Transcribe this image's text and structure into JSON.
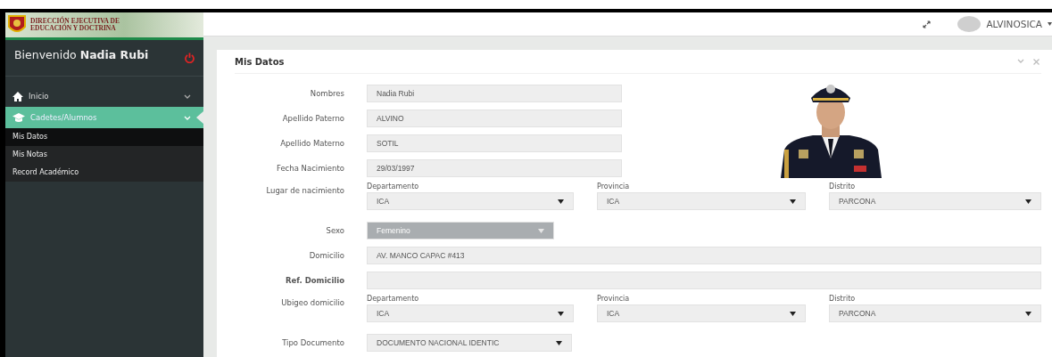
{
  "logo": {
    "line1": "DIRECCIÓN EJECUTIVA DE",
    "line2": "EDUCACIÓN Y DOCTRINA"
  },
  "header": {
    "user": "ALVINOSICA"
  },
  "sidebar": {
    "welcome": "Bienvenido",
    "user": "Nadia Rubi",
    "items": [
      {
        "label": "Inicio",
        "selected": false,
        "expanded": false
      },
      {
        "label": "Cadetes/Alumnos",
        "selected": true,
        "expanded": true,
        "children": [
          {
            "label": "Mis Datos",
            "selected": true
          },
          {
            "label": "Mis Notas",
            "selected": false
          },
          {
            "label": "Record Académico",
            "selected": false
          }
        ]
      }
    ]
  },
  "panel": {
    "title": "Mis Datos",
    "fields": [
      {
        "kind": "text",
        "label": "Nombres",
        "value": "Nadia Rubi"
      },
      {
        "kind": "text",
        "label": "Apellido Paterno",
        "value": "ALVINO"
      },
      {
        "kind": "text",
        "label": "Apellido Materno",
        "value": "SOTIL"
      },
      {
        "kind": "text",
        "label": "Fecha Nacimiento",
        "value": "29/03/1997"
      },
      {
        "kind": "location",
        "label": "Lugar de nacimiento",
        "parts": [
          {
            "caption": "Departamento",
            "value": "ICA"
          },
          {
            "caption": "Provincia",
            "value": "ICA"
          },
          {
            "caption": "Distrito",
            "value": "PARCONA"
          }
        ]
      },
      {
        "kind": "select",
        "label": "Sexo",
        "value": "Femenino",
        "disabled": true
      },
      {
        "kind": "wide",
        "label": "Domicilio",
        "value": "AV. MANCO CAPAC #413"
      },
      {
        "kind": "wide",
        "label": "Ref. Domicilio",
        "bold": true
      },
      {
        "kind": "location",
        "label": "Ubigeo domicilio",
        "parts": [
          {
            "caption": "Departamento",
            "value": "ICA"
          },
          {
            "caption": "Provincia",
            "value": "ICA"
          },
          {
            "caption": "Distrito",
            "value": "PARCONA"
          }
        ]
      },
      {
        "kind": "select",
        "label": "Tipo Documento",
        "value": "DOCUMENTO NACIONAL IDENTIC",
        "disabled": false
      }
    ]
  }
}
